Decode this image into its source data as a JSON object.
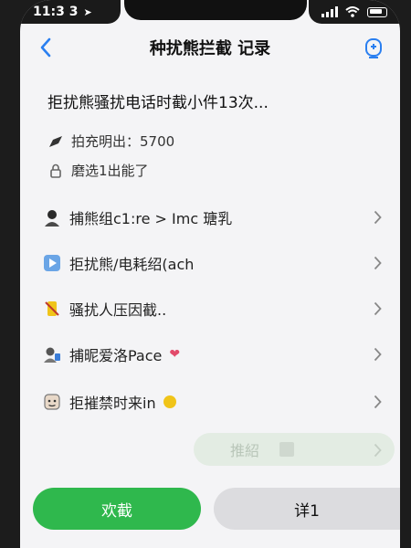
{
  "status_bar": {
    "time": "11:3 3",
    "location_icon": "location-arrow-icon",
    "signal_icon": "signal-bars-icon",
    "wifi_icon": "wifi-icon",
    "battery_icon": "battery-icon"
  },
  "nav": {
    "back_icon": "chevron-left-icon",
    "title": "种扰熊拦截 记录",
    "action_icon": "bell-badge-icon"
  },
  "headline": "拒扰熊骚扰电话时截小件13次...",
  "info": [
    {
      "icon": "pen-icon",
      "text": "拍充明出：5700"
    },
    {
      "icon": "lock-icon",
      "text": "磨选1出能了"
    }
  ],
  "list": [
    {
      "icon": "person-icon",
      "label": "捕熊组c1:re > Imc 瑭乳"
    },
    {
      "icon": "play-icon",
      "label": "拒扰熊/电耗绍(ach"
    },
    {
      "icon": "phone-slash-icon",
      "label": "骚扰人压因截.."
    },
    {
      "icon": "avatar-icon",
      "label": "捕昵爱洛Pace"
    },
    {
      "icon": "shield-face-icon",
      "label": "拒摧禁时来in"
    }
  ],
  "tag_pill": {
    "label": "推紹",
    "icon": "document-icon"
  },
  "buttons": {
    "primary": "欢截",
    "secondary": "详1"
  },
  "colors": {
    "accent_blue": "#2a7ff0",
    "primary_green": "#2fb84d",
    "heart": "#e24a6a",
    "dot_yellow": "#f0c419"
  }
}
